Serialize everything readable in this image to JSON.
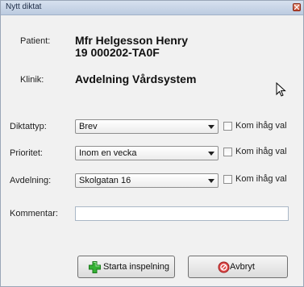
{
  "window": {
    "title": "Nytt diktat",
    "close_icon": "close-icon"
  },
  "patient": {
    "label": "Patient:",
    "name": "Mfr Helgesson Henry",
    "id": "19 000202-TA0F"
  },
  "clinic": {
    "label": "Klinik:",
    "value": "Avdelning Vårdsystem"
  },
  "dictation_type": {
    "label": "Diktattyp:",
    "selected": "Brev",
    "remember_label": "Kom ihåg val",
    "remember_checked": false
  },
  "priority": {
    "label": "Prioritet:",
    "selected": "Inom en vecka",
    "remember_label": "Kom ihåg val",
    "remember_checked": false
  },
  "department": {
    "label": "Avdelning:",
    "selected": "Skolgatan 16",
    "remember_label": "Kom ihåg val",
    "remember_checked": false
  },
  "comment": {
    "label": "Kommentar:",
    "value": ""
  },
  "buttons": {
    "start": {
      "label": "Starta inspelning",
      "icon": "green-plus-icon"
    },
    "cancel": {
      "label": "Avbryt",
      "icon": "cancel-icon"
    }
  },
  "colors": {
    "titlebar": "#c8d5e8",
    "dialog_bg": "#f1f1f1",
    "plus_green": "#2fa52f",
    "cancel_red": "#d23a3a"
  }
}
